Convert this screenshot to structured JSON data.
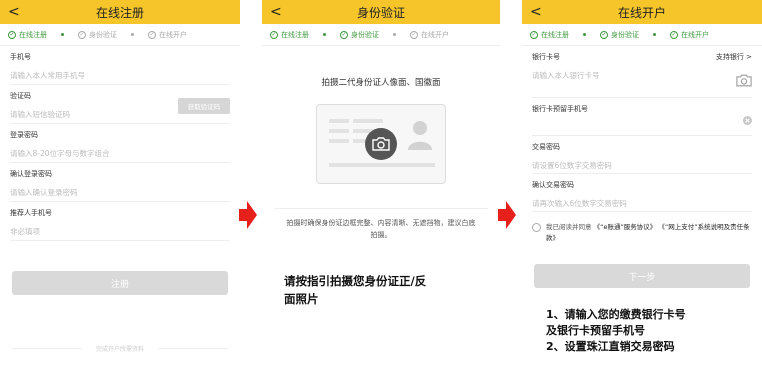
{
  "screen1": {
    "back": "<",
    "title": "在线注册",
    "steps": [
      "在线注册",
      "身份验证",
      "在线开户"
    ],
    "fields": [
      {
        "label": "手机号",
        "placeholder": "请输入本人常用手机号"
      },
      {
        "label": "验证码",
        "placeholder": "请输入短信验证码"
      },
      {
        "label": "登录密码",
        "placeholder": "请输入8-20位字母与数字组合"
      },
      {
        "label": "确认登录密码",
        "placeholder": "请输入确认登录密码"
      },
      {
        "label": "推荐人手机号",
        "placeholder": "非必填项"
      }
    ],
    "verify_button": "获取验证码",
    "submit": "注册",
    "footer": "完成开户所需资料"
  },
  "screen2": {
    "back": "<",
    "title": "身份验证",
    "steps": [
      "在线注册",
      "身份验证",
      "在线开户"
    ],
    "heading": "拍摄二代身份证人像面、国徽面",
    "tip": "拍摄时确保身份证边框完整、内容清晰、无遮挡物，建议白底拍摄。"
  },
  "screen3": {
    "back": "<",
    "title": "在线开户",
    "steps": [
      "在线注册",
      "身份验证",
      "在线开户"
    ],
    "fields": [
      {
        "label": "银行卡号",
        "placeholder": "请输入本人银行卡号"
      },
      {
        "label": "银行卡预留手机号",
        "placeholder": ""
      },
      {
        "label": "交易密码",
        "placeholder": "请设置6位数字交易密码"
      },
      {
        "label": "确认交易密码",
        "placeholder": "请再次输入6位数字交易密码"
      }
    ],
    "support_bank": "支持银行 >",
    "agreement_prefix": "我已阅读并同意",
    "agreement_doc1": "《“e账通”服务协议》",
    "agreement_doc2": "《“网上支付”系统说明及责任条款》",
    "next": "下一步"
  },
  "captions": {
    "middle_line1": "请按指引拍摄您身份证正/反",
    "middle_line2": "面照片",
    "right_line1": "1、请输入您的缴费银行卡号",
    "right_line2": "及银行卡预留手机号",
    "right_line3": "2、设置珠江直销交易密码"
  },
  "colors": {
    "header": "#f5c52a",
    "active_step": "#3f9a3f",
    "arrow": "#e8201c"
  },
  "icons": {
    "arrow": "red-right-arrow",
    "camera": "camera-icon",
    "clear": "clear-icon"
  }
}
